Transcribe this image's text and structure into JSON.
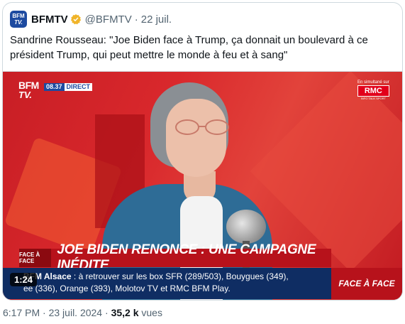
{
  "tweet": {
    "account_name": "BFMTV",
    "handle": "@BFMTV",
    "separator": "·",
    "date": "22 juil.",
    "text": "Sandrine Rousseau: \"Joe Biden face à Trump, ça donnait un boulevard à ce président Trump, qui peut mettre le monde à feu et à sang\"",
    "avatar_lines": [
      "BFM",
      "TV."
    ]
  },
  "media": {
    "duration": "1:24",
    "logo_lines": [
      "BFM",
      "TV."
    ],
    "time": "08.37",
    "live_label": "DIRECT",
    "rmc_simul": "En simultané sur",
    "rmc_logo": "RMC",
    "rmc_tagline": "INFO TALK SPORT",
    "face_a_face_small": "FACE À FACE",
    "headline": "JOE BIDEN RENONCE : UNE CAMPAGNE INÉDITE",
    "ticker_brand": "BFM Alsace",
    "ticker_line1": " : à retrouver sur les box SFR (289/503), Bouygues (349),",
    "ticker_line2": "ee (336), Orange (393), Molotov TV et RMC BFM Play.",
    "face_a_face_right": "FACE À FACE"
  },
  "footer": {
    "time": "6:17 PM",
    "sep": " · ",
    "date": "23 juil. 2024",
    "views_count": "35,2 k",
    "views_label": " vues"
  },
  "colors": {
    "verified": "#f0b429",
    "bfm_blue": "#1d4aa0",
    "bfm_red": "#b7121b",
    "muted_text": "#536471"
  }
}
